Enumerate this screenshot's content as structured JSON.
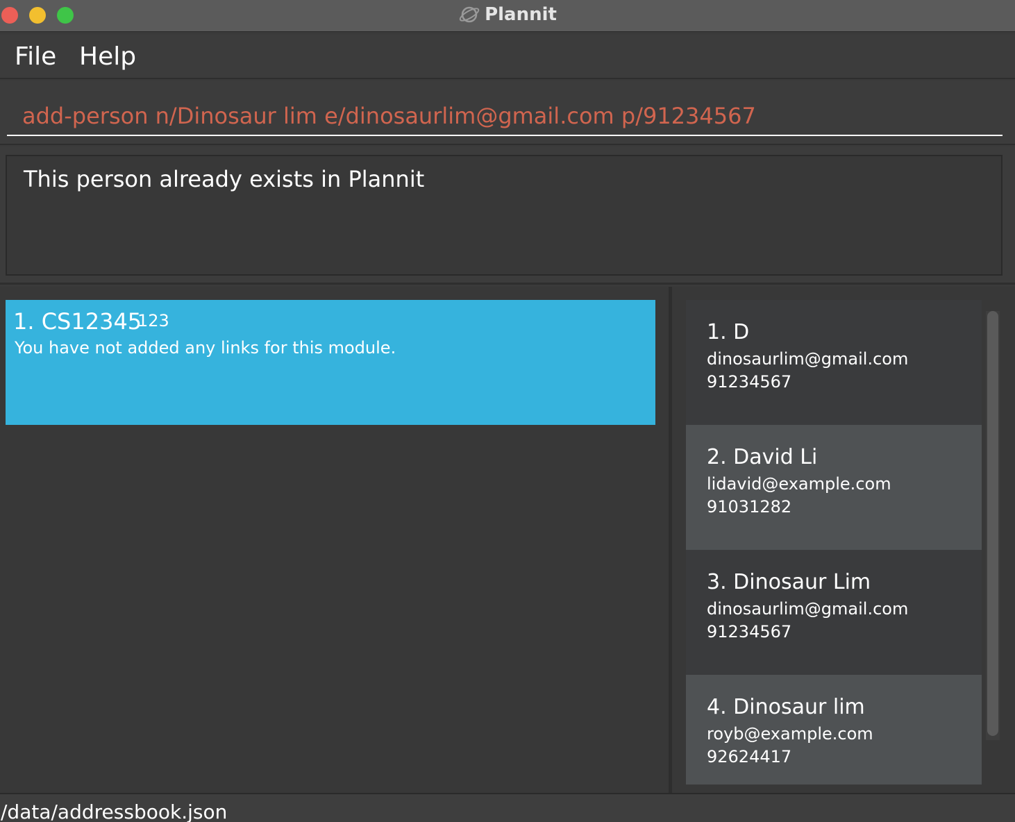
{
  "window": {
    "title": "Plannit",
    "app_icon": "planet-icon"
  },
  "menu": {
    "file_label": "File",
    "help_label": "Help"
  },
  "command": {
    "value": "add-person n/Dinosaur lim e/dinosaurlim@gmail.com p/91234567",
    "error_color": "#d1654f"
  },
  "result": {
    "message": "This person already exists in Plannit"
  },
  "modules": [
    {
      "index": "1.",
      "code": "CS12345",
      "title": "1.  CS12345",
      "tag": "123",
      "links_text": "You have not added any links for this module.",
      "color": "#36b3dd"
    }
  ],
  "persons": [
    {
      "title": "1.  D",
      "email": "dinosaurlim@gmail.com",
      "phone": "91234567"
    },
    {
      "title": "2.  David Li",
      "email": "lidavid@example.com",
      "phone": "91031282"
    },
    {
      "title": "3.  Dinosaur Lim",
      "email": "dinosaurlim@gmail.com",
      "phone": "91234567"
    },
    {
      "title": "4.  Dinosaur lim",
      "email": "royb@example.com",
      "phone": "92624417"
    }
  ],
  "status": {
    "file_path": "/data/addressbook.json"
  }
}
